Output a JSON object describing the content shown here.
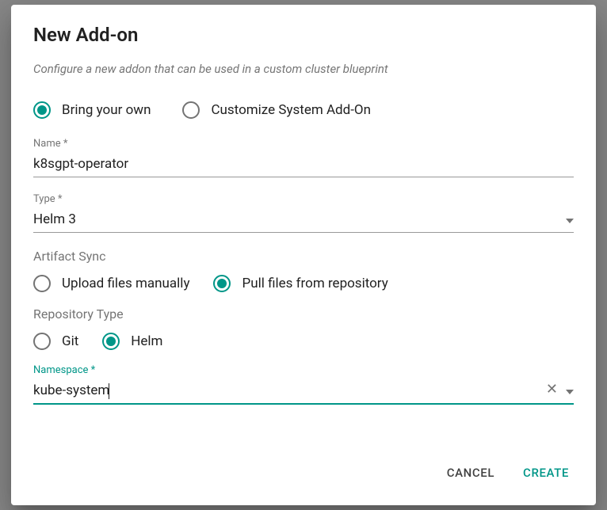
{
  "dialog": {
    "title": "New Add-on",
    "subtitle": "Configure a new addon that can be used in a custom cluster blueprint"
  },
  "addon_mode": {
    "bring_your_own": "Bring your own",
    "customize_system": "Customize System Add-On"
  },
  "fields": {
    "name_label": "Name *",
    "name_value": "k8sgpt-operator",
    "type_label": "Type *",
    "type_value": "Helm 3",
    "artifact_sync_label": "Artifact Sync",
    "upload_manually": "Upload files manually",
    "pull_from_repo": "Pull files from repository",
    "repository_type_label": "Repository Type",
    "repo_git": "Git",
    "repo_helm": "Helm",
    "namespace_label": "Namespace *",
    "namespace_value": "kube-system"
  },
  "actions": {
    "cancel": "CANCEL",
    "create": "CREATE"
  }
}
